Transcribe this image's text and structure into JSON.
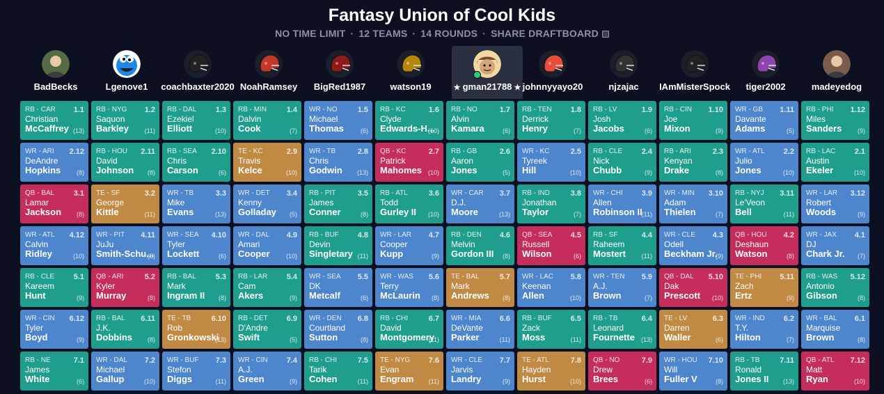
{
  "header": {
    "title": "Fantasy Union of Cool Kids",
    "time_limit": "NO TIME LIMIT",
    "teams_count": "12 TEAMS",
    "rounds_count": "14 ROUNDS",
    "share_label": "SHARE DRAFTBOARD"
  },
  "colors": {
    "background": "#0c1021",
    "RB": "#1f9e8d",
    "WR": "#4d86cc",
    "QB": "#c42d5c",
    "TE": "#c08a45"
  },
  "teams": [
    {
      "name": "BadBecks",
      "avatar": "person-photo",
      "avatar_color": "#556b44"
    },
    {
      "name": "Lgenove1",
      "avatar": "cookie-monster",
      "avatar_color": "#1e88e5"
    },
    {
      "name": "coachbaxter2020",
      "avatar": "helmet-black",
      "avatar_color": "#222222"
    },
    {
      "name": "NoahRamsey",
      "avatar": "helmet-red",
      "avatar_color": "#c0392b"
    },
    {
      "name": "BigRed1987",
      "avatar": "helmet-red-black",
      "avatar_color": "#8e1b1b"
    },
    {
      "name": "watson19",
      "avatar": "helmet-gold",
      "avatar_color": "#b8860b"
    },
    {
      "name": "gman21788",
      "avatar": "cartoon-face",
      "avatar_color": "#d2a679",
      "active": true,
      "marker": "★"
    },
    {
      "name": "johnnyyayo20",
      "avatar": "helmet-red-white",
      "avatar_color": "#e74c3c"
    },
    {
      "name": "njzajac",
      "avatar": "helmet-black",
      "avatar_color": "#333333"
    },
    {
      "name": "IAmMisterSpock",
      "avatar": "helmet-black",
      "avatar_color": "#222222"
    },
    {
      "name": "tiger2002",
      "avatar": "helmet-purple",
      "avatar_color": "#8e44ad"
    },
    {
      "name": "madeyedog",
      "avatar": "person-photo",
      "avatar_color": "#7a5c4d"
    }
  ],
  "picks": [
    [
      {
        "pos": "RB - CAR",
        "pick": "1.1",
        "first": "Christian",
        "last": "McCaffrey",
        "bye": "(13)"
      },
      {
        "pos": "RB - NYG",
        "pick": "1.2",
        "first": "Saquon",
        "last": "Barkley",
        "bye": "(11)"
      },
      {
        "pos": "RB - DAL",
        "pick": "1.3",
        "first": "Ezekiel",
        "last": "Elliott",
        "bye": "(10)"
      },
      {
        "pos": "RB - MIN",
        "pick": "1.4",
        "first": "Dalvin",
        "last": "Cook",
        "bye": "(7)"
      },
      {
        "pos": "WR - NO",
        "pick": "1.5",
        "first": "Michael",
        "last": "Thomas",
        "bye": "(6)"
      },
      {
        "pos": "RB - KC",
        "pick": "1.6",
        "first": "Clyde",
        "last": "Edwards-H...",
        "bye": "(10)"
      },
      {
        "pos": "RB - NO",
        "pick": "1.7",
        "first": "Alvin",
        "last": "Kamara",
        "bye": "(6)"
      },
      {
        "pos": "RB - TEN",
        "pick": "1.8",
        "first": "Derrick",
        "last": "Henry",
        "bye": "(7)"
      },
      {
        "pos": "RB - LV",
        "pick": "1.9",
        "first": "Josh",
        "last": "Jacobs",
        "bye": "(6)"
      },
      {
        "pos": "RB - CIN",
        "pick": "1.10",
        "first": "Joe",
        "last": "Mixon",
        "bye": "(9)"
      },
      {
        "pos": "WR - GB",
        "pick": "1.11",
        "first": "Davante",
        "last": "Adams",
        "bye": "(5)"
      },
      {
        "pos": "RB - PHI",
        "pick": "1.12",
        "first": "Miles",
        "last": "Sanders",
        "bye": "(9)"
      }
    ],
    [
      {
        "pos": "WR - ARI",
        "pick": "2.12",
        "first": "DeAndre",
        "last": "Hopkins",
        "bye": "(8)"
      },
      {
        "pos": "RB - HOU",
        "pick": "2.11",
        "first": "David",
        "last": "Johnson",
        "bye": "(8)"
      },
      {
        "pos": "RB - SEA",
        "pick": "2.10",
        "first": "Chris",
        "last": "Carson",
        "bye": "(6)"
      },
      {
        "pos": "TE - KC",
        "pick": "2.9",
        "first": "Travis",
        "last": "Kelce",
        "bye": "(10)"
      },
      {
        "pos": "WR - TB",
        "pick": "2.8",
        "first": "Chris",
        "last": "Godwin",
        "bye": "(13)"
      },
      {
        "pos": "QB - KC",
        "pick": "2.7",
        "first": "Patrick",
        "last": "Mahomes",
        "bye": "(10)"
      },
      {
        "pos": "RB - GB",
        "pick": "2.6",
        "first": "Aaron",
        "last": "Jones",
        "bye": "(5)"
      },
      {
        "pos": "WR - KC",
        "pick": "2.5",
        "first": "Tyreek",
        "last": "Hill",
        "bye": "(10)"
      },
      {
        "pos": "RB - CLE",
        "pick": "2.4",
        "first": "Nick",
        "last": "Chubb",
        "bye": "(9)"
      },
      {
        "pos": "RB - ARI",
        "pick": "2.3",
        "first": "Kenyan",
        "last": "Drake",
        "bye": "(8)"
      },
      {
        "pos": "WR - ATL",
        "pick": "2.2",
        "first": "Julio",
        "last": "Jones",
        "bye": "(10)"
      },
      {
        "pos": "RB - LAC",
        "pick": "2.1",
        "first": "Austin",
        "last": "Ekeler",
        "bye": "(10)"
      }
    ],
    [
      {
        "pos": "QB - BAL",
        "pick": "3.1",
        "first": "Lamar",
        "last": "Jackson",
        "bye": "(8)"
      },
      {
        "pos": "TE - SF",
        "pick": "3.2",
        "first": "George",
        "last": "Kittle",
        "bye": "(11)"
      },
      {
        "pos": "WR - TB",
        "pick": "3.3",
        "first": "Mike",
        "last": "Evans",
        "bye": "(13)"
      },
      {
        "pos": "WR - DET",
        "pick": "3.4",
        "first": "Kenny",
        "last": "Golladay",
        "bye": "(5)"
      },
      {
        "pos": "RB - PIT",
        "pick": "3.5",
        "first": "James",
        "last": "Conner",
        "bye": "(8)"
      },
      {
        "pos": "RB - ATL",
        "pick": "3.6",
        "first": "Todd",
        "last": "Gurley II",
        "bye": "(10)"
      },
      {
        "pos": "WR - CAR",
        "pick": "3.7",
        "first": "D.J.",
        "last": "Moore",
        "bye": "(13)"
      },
      {
        "pos": "RB - IND",
        "pick": "3.8",
        "first": "Jonathan",
        "last": "Taylor",
        "bye": "(7)"
      },
      {
        "pos": "WR - CHI",
        "pick": "3.9",
        "first": "Allen",
        "last": "Robinson II",
        "bye": "(11)"
      },
      {
        "pos": "WR - MIN",
        "pick": "3.10",
        "first": "Adam",
        "last": "Thielen",
        "bye": "(7)"
      },
      {
        "pos": "RB - NYJ",
        "pick": "3.11",
        "first": "Le'Veon",
        "last": "Bell",
        "bye": "(11)"
      },
      {
        "pos": "WR - LAR",
        "pick": "3.12",
        "first": "Robert",
        "last": "Woods",
        "bye": "(9)"
      }
    ],
    [
      {
        "pos": "WR - ATL",
        "pick": "4.12",
        "first": "Calvin",
        "last": "Ridley",
        "bye": "(10)"
      },
      {
        "pos": "WR - PIT",
        "pick": "4.11",
        "first": "JuJu",
        "last": "Smith-Schu...",
        "bye": "(8)"
      },
      {
        "pos": "WR - SEA",
        "pick": "4.10",
        "first": "Tyler",
        "last": "Lockett",
        "bye": "(6)"
      },
      {
        "pos": "WR - DAL",
        "pick": "4.9",
        "first": "Amari",
        "last": "Cooper",
        "bye": "(10)"
      },
      {
        "pos": "RB - BUF",
        "pick": "4.8",
        "first": "Devin",
        "last": "Singletary",
        "bye": "(11)"
      },
      {
        "pos": "WR - LAR",
        "pick": "4.7",
        "first": "Cooper",
        "last": "Kupp",
        "bye": "(9)"
      },
      {
        "pos": "RB - DEN",
        "pick": "4.6",
        "first": "Melvin",
        "last": "Gordon III",
        "bye": "(8)"
      },
      {
        "pos": "QB - SEA",
        "pick": "4.5",
        "first": "Russell",
        "last": "Wilson",
        "bye": "(6)"
      },
      {
        "pos": "RB - SF",
        "pick": "4.4",
        "first": "Raheem",
        "last": "Mostert",
        "bye": "(11)"
      },
      {
        "pos": "WR - CLE",
        "pick": "4.3",
        "first": "Odell",
        "last": "Beckham Jr.",
        "bye": "(9)"
      },
      {
        "pos": "QB - HOU",
        "pick": "4.2",
        "first": "Deshaun",
        "last": "Watson",
        "bye": "(8)"
      },
      {
        "pos": "WR - JAX",
        "pick": "4.1",
        "first": "DJ",
        "last": "Chark Jr.",
        "bye": "(7)"
      }
    ],
    [
      {
        "pos": "RB - CLE",
        "pick": "5.1",
        "first": "Kareem",
        "last": "Hunt",
        "bye": "(9)"
      },
      {
        "pos": "QB - ARI",
        "pick": "5.2",
        "first": "Kyler",
        "last": "Murray",
        "bye": "(8)"
      },
      {
        "pos": "RB - BAL",
        "pick": "5.3",
        "first": "Mark",
        "last": "Ingram II",
        "bye": "(8)"
      },
      {
        "pos": "RB - LAR",
        "pick": "5.4",
        "first": "Cam",
        "last": "Akers",
        "bye": "(9)"
      },
      {
        "pos": "WR - SEA",
        "pick": "5.5",
        "first": "DK",
        "last": "Metcalf",
        "bye": "(6)"
      },
      {
        "pos": "WR - WAS",
        "pick": "5.6",
        "first": "Terry",
        "last": "McLaurin",
        "bye": "(8)"
      },
      {
        "pos": "TE - BAL",
        "pick": "5.7",
        "first": "Mark",
        "last": "Andrews",
        "bye": "(8)"
      },
      {
        "pos": "WR - LAC",
        "pick": "5.8",
        "first": "Keenan",
        "last": "Allen",
        "bye": "(10)"
      },
      {
        "pos": "WR - TEN",
        "pick": "5.9",
        "first": "A.J.",
        "last": "Brown",
        "bye": "(7)"
      },
      {
        "pos": "QB - DAL",
        "pick": "5.10",
        "first": "Dak",
        "last": "Prescott",
        "bye": "(10)"
      },
      {
        "pos": "TE - PHI",
        "pick": "5.11",
        "first": "Zach",
        "last": "Ertz",
        "bye": "(9)"
      },
      {
        "pos": "RB - WAS",
        "pick": "5.12",
        "first": "Antonio",
        "last": "Gibson",
        "bye": "(8)"
      }
    ],
    [
      {
        "pos": "WR - CIN",
        "pick": "6.12",
        "first": "Tyler",
        "last": "Boyd",
        "bye": "(9)"
      },
      {
        "pos": "RB - BAL",
        "pick": "6.11",
        "first": "J.K.",
        "last": "Dobbins",
        "bye": "(8)"
      },
      {
        "pos": "TE - TB",
        "pick": "6.10",
        "first": "Rob",
        "last": "Gronkowski",
        "bye": "(13)"
      },
      {
        "pos": "RB - DET",
        "pick": "6.9",
        "first": "D'Andre",
        "last": "Swift",
        "bye": "(5)"
      },
      {
        "pos": "WR - DEN",
        "pick": "6.8",
        "first": "Courtland",
        "last": "Sutton",
        "bye": "(8)"
      },
      {
        "pos": "RB - CHI",
        "pick": "6.7",
        "first": "David",
        "last": "Montgomery",
        "bye": "(11)"
      },
      {
        "pos": "WR - MIA",
        "pick": "6.6",
        "first": "DeVante",
        "last": "Parker",
        "bye": "(11)"
      },
      {
        "pos": "RB - BUF",
        "pick": "6.5",
        "first": "Zack",
        "last": "Moss",
        "bye": "(11)"
      },
      {
        "pos": "RB - TB",
        "pick": "6.4",
        "first": "Leonard",
        "last": "Fournette",
        "bye": "(13)"
      },
      {
        "pos": "TE - LV",
        "pick": "6.3",
        "first": "Darren",
        "last": "Waller",
        "bye": "(6)"
      },
      {
        "pos": "WR - IND",
        "pick": "6.2",
        "first": "T.Y.",
        "last": "Hilton",
        "bye": "(7)"
      },
      {
        "pos": "WR - BAL",
        "pick": "6.1",
        "first": "Marquise",
        "last": "Brown",
        "bye": "(8)"
      }
    ],
    [
      {
        "pos": "RB - NE",
        "pick": "7.1",
        "first": "James",
        "last": "White",
        "bye": "(6)"
      },
      {
        "pos": "WR - DAL",
        "pick": "7.2",
        "first": "Michael",
        "last": "Gallup",
        "bye": "(10)"
      },
      {
        "pos": "WR - BUF",
        "pick": "7.3",
        "first": "Stefon",
        "last": "Diggs",
        "bye": "(11)"
      },
      {
        "pos": "WR - CIN",
        "pick": "7.4",
        "first": "A.J.",
        "last": "Green",
        "bye": "(9)"
      },
      {
        "pos": "RB - CHI",
        "pick": "7.5",
        "first": "Tarik",
        "last": "Cohen",
        "bye": "(11)"
      },
      {
        "pos": "TE - NYG",
        "pick": "7.6",
        "first": "Evan",
        "last": "Engram",
        "bye": "(11)"
      },
      {
        "pos": "WR - CLE",
        "pick": "7.7",
        "first": "Jarvis",
        "last": "Landry",
        "bye": "(9)"
      },
      {
        "pos": "TE - ATL",
        "pick": "7.8",
        "first": "Hayden",
        "last": "Hurst",
        "bye": "(10)"
      },
      {
        "pos": "QB - NO",
        "pick": "7.9",
        "first": "Drew",
        "last": "Brees",
        "bye": "(6)"
      },
      {
        "pos": "WR - HOU",
        "pick": "7.10",
        "first": "Will",
        "last": "Fuller V",
        "bye": "(8)"
      },
      {
        "pos": "RB - TB",
        "pick": "7.11",
        "first": "Ronald",
        "last": "Jones II",
        "bye": "(13)"
      },
      {
        "pos": "QB - ATL",
        "pick": "7.12",
        "first": "Matt",
        "last": "Ryan",
        "bye": "(10)"
      }
    ]
  ]
}
